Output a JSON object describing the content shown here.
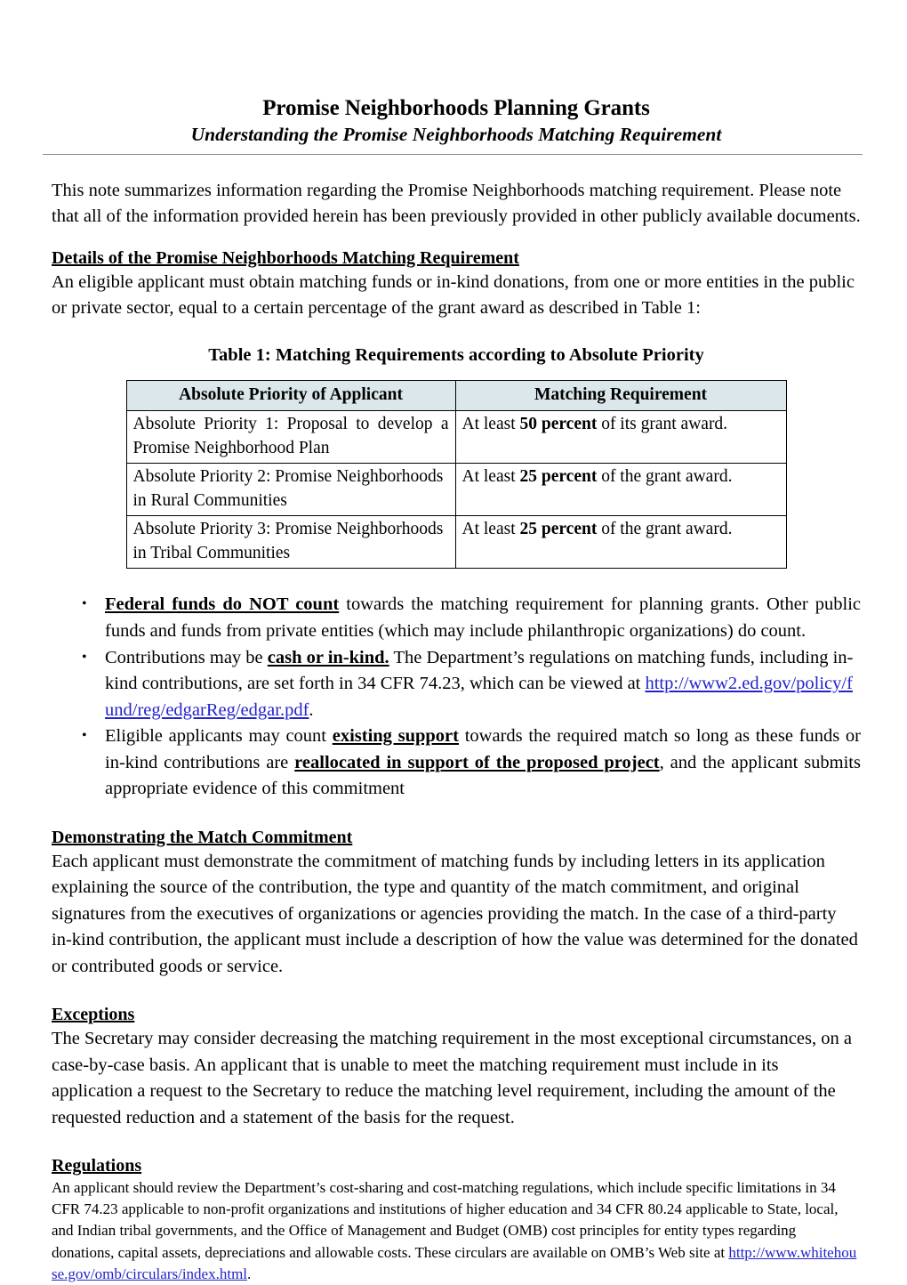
{
  "document": {
    "title": "Promise Neighborhoods Planning Grants",
    "subtitle": "Understanding the Promise Neighborhoods Matching Requirement"
  },
  "intro": {
    "text": "This note summarizes information regarding the Promise Neighborhoods matching requirement.  Please note that all of the information provided herein has been previously provided in other publicly available documents."
  },
  "details_section": {
    "heading": "Details of the Promise Neighborhoods Matching Requirement",
    "text": "An eligible applicant must obtain matching funds or in-kind donations, from one or more entities in the public or private sector, equal to a certain percentage of the grant award as described in Table 1:"
  },
  "table": {
    "caption": "Table 1: Matching Requirements according to Absolute Priority",
    "headers": [
      "Absolute Priority of Applicant",
      "Matching Requirement"
    ],
    "header_bg": "#dbe7ea",
    "rows": [
      {
        "priority": "Absolute Priority 1: Proposal to develop a Promise Neighborhood Plan",
        "requirement_prefix": "At least ",
        "requirement_bold": "50 percent",
        "requirement_suffix": " of its grant award."
      },
      {
        "priority": "Absolute Priority 2: Promise Neighborhoods in Rural Communities",
        "requirement_prefix": "At least ",
        "requirement_bold": "25 percent",
        "requirement_suffix": " of the grant award."
      },
      {
        "priority": "Absolute Priority 3: Promise Neighborhoods in Tribal Communities",
        "requirement_prefix": "At least ",
        "requirement_bold": "25 percent",
        "requirement_suffix": " of the grant award."
      }
    ]
  },
  "bullets": [
    {
      "emphasis": "Federal funds do NOT count",
      "text": " towards the matching requirement for planning grants.  Other public funds and funds from private entities (which may include philanthropic organizations) do count."
    },
    {
      "lead": "Contributions may be ",
      "emphasis": "cash or in-kind.",
      "text": "  The Department’s regulations on matching funds, including in-kind contributions, are set forth in 34 CFR 74.23, which can be viewed at ",
      "link": "http://www2.ed.gov/policy/fund/reg/edgarReg/edgar.pdf",
      "tail": "."
    },
    {
      "lead": "Eligible applicants may count ",
      "emphasis": "existing support",
      "mid": " towards the required match so long as these funds or in-kind contributions are ",
      "emphasis2": "reallocated in support of the proposed project",
      "tail": ", and the applicant submits appropriate evidence of this commitment"
    }
  ],
  "demonstrating_section": {
    "heading": "Demonstrating the Match Commitment",
    "text": "Each applicant must demonstrate the commitment of matching funds by including letters in its application explaining the source of the contribution, the type and quantity of the match commitment, and original signatures from the executives of organizations or agencies providing the match.  In the case of a third-party in-kind contribution, the applicant must include a description of how the value was determined for the donated or contributed goods or service."
  },
  "exceptions_section": {
    "heading": "Exceptions",
    "text": "The Secretary may consider decreasing the matching requirement in the most exceptional circumstances, on a case-by-case basis. An applicant that is unable to meet the matching requirement must include in its application a request to the Secretary to reduce the matching level requirement, including the amount of the requested reduction and a statement of the basis for the request."
  },
  "regulations_section": {
    "heading": "Regulations",
    "text": "An applicant should review the Department’s cost-sharing and cost-matching regulations, which include specific limitations in 34 CFR 74.23 applicable to non-profit organizations and institutions of higher education and 34 CFR 80.24 applicable to State, local, and Indian tribal governments, and the Office of Management and Budget (OMB) cost principles for entity types regarding donations, capital assets, depreciations and allowable costs.  These circulars are available on OMB’s Web site at ",
    "link": "http://www.whitehouse.gov/omb/circulars/index.html",
    "tail": "."
  },
  "colors": {
    "link": "#2222cc",
    "table_header_bg": "#dbe7ea",
    "rule": "#8a8a8a"
  }
}
